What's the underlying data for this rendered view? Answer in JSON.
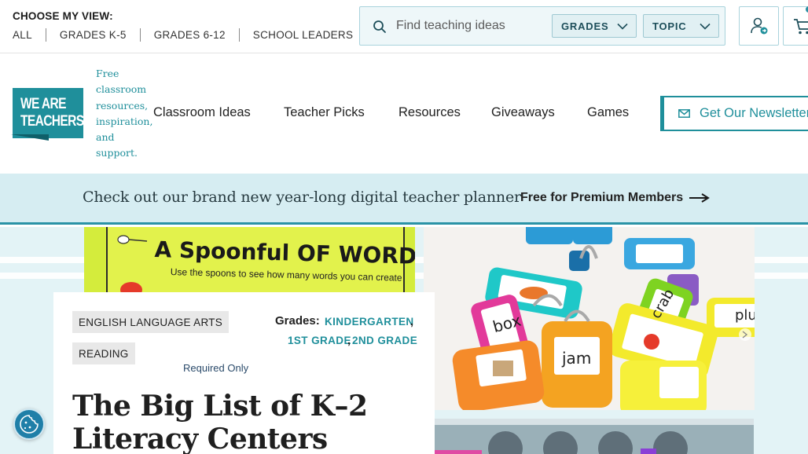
{
  "topbar": {
    "view_label": "CHOOSE MY VIEW:",
    "view_links": [
      "ALL",
      "GRADES K-5",
      "GRADES 6-12",
      "SCHOOL LEADERS"
    ]
  },
  "search": {
    "placeholder": "Find teaching ideas",
    "value": "",
    "filters": [
      "GRADES",
      "TOPIC"
    ]
  },
  "header": {
    "logo_text": "WE ARE TEACHERS",
    "tagline": "Free classroom resources, inspiration, and support.",
    "nav": [
      "Classroom Ideas",
      "Teacher Picks",
      "Resources",
      "Giveaways",
      "Games"
    ],
    "newsletter_label": "Get Our Newsletter"
  },
  "promo": {
    "text": "Check out our brand new year-long digital teacher planner",
    "link_label": "Free for Premium Members"
  },
  "hero": {
    "image1_title": "A Spoonful OF WORDS",
    "image1_subtitle": "Use the spoons to see how many words you can create",
    "image2_words": [
      "box",
      "jam",
      "crab",
      "plu"
    ]
  },
  "article": {
    "tags": [
      "ENGLISH LANGUAGE ARTS",
      "READING"
    ],
    "grades_label": "Grades:",
    "grades": [
      "KINDERGARTEN",
      "1ST GRADE",
      "2ND GRADE"
    ],
    "required_note": "Required Only",
    "title": "The Big List of K–2 Literacy Centers"
  },
  "colors": {
    "brand_teal": "#1f8f9b",
    "promo_bg": "#d6edf2",
    "content_bg": "#e3f3f6"
  },
  "icons": {
    "search": "search-icon",
    "account": "user-account-icon",
    "cart": "cart-icon",
    "newsletter": "envelope-icon",
    "promo_arrow": "arrow-right-icon",
    "cookie": "cookie-icon"
  }
}
